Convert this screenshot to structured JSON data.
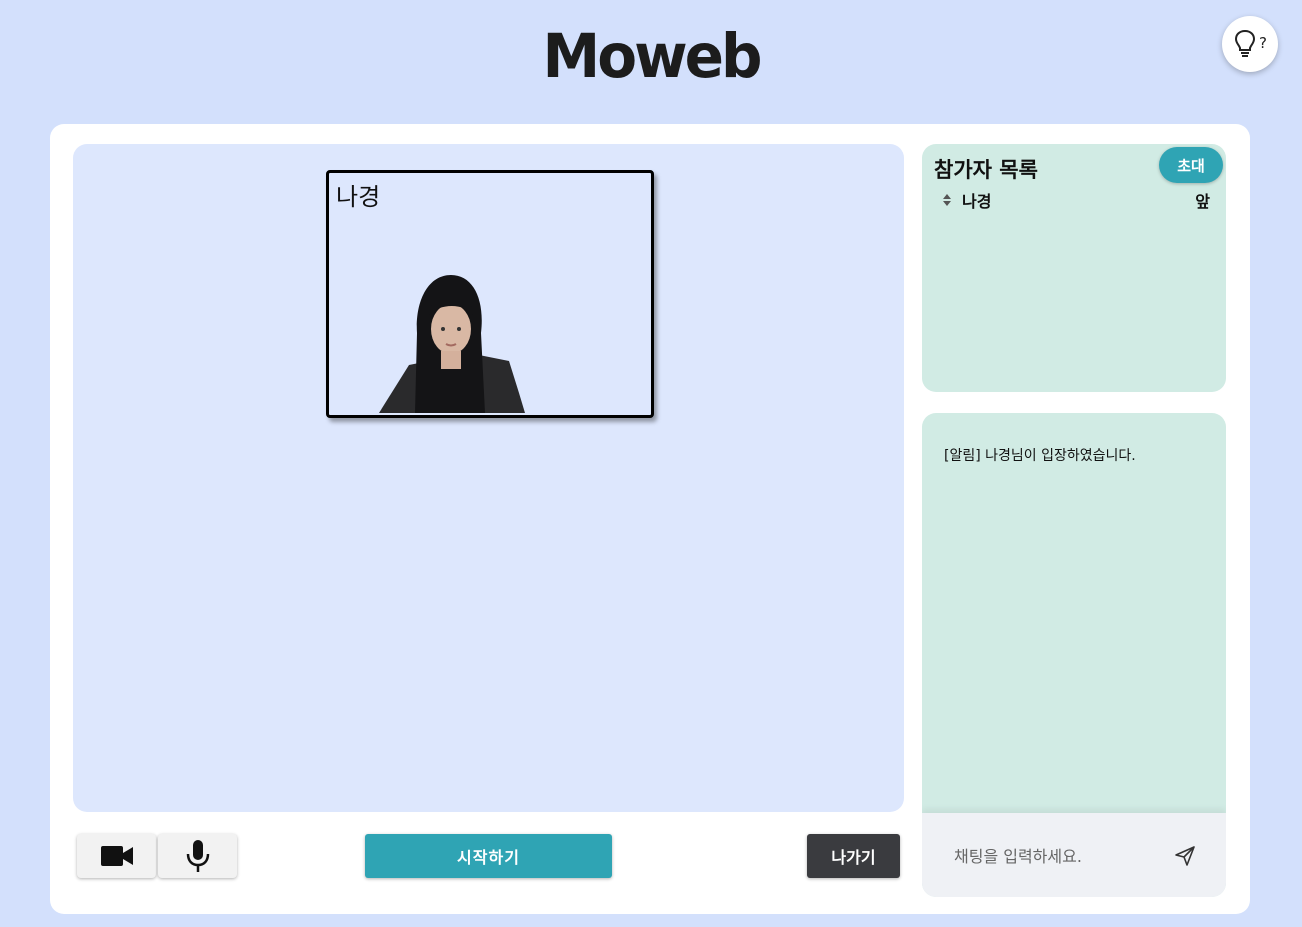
{
  "header": {
    "logo": "Moweb",
    "help_label": "?"
  },
  "video": {
    "participant_name": "나경"
  },
  "controls": {
    "camera_icon": "video-camera-icon",
    "mic_icon": "microphone-icon",
    "start_label": "시작하기",
    "leave_label": "나가기"
  },
  "participants": {
    "title": "참가자 목록",
    "invite_label": "초대",
    "items": [
      {
        "name": "나경",
        "status": "앞"
      }
    ]
  },
  "chat": {
    "messages": [
      "[알림] 나경님이 입장하였습니다."
    ],
    "placeholder": "채팅을 입력하세요."
  },
  "colors": {
    "background": "#d3e0fc",
    "stage": "#dde7fd",
    "panel": "#d1ebe4",
    "accent": "#2fa4b4",
    "dark_button": "#3a3b3f"
  }
}
